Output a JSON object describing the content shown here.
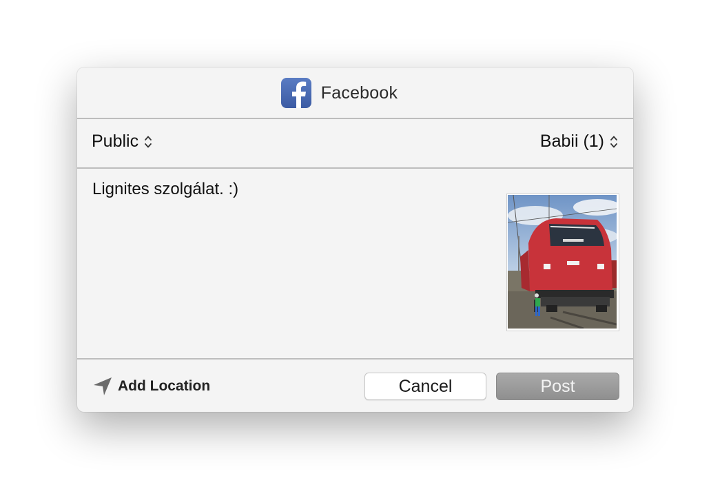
{
  "dialog": {
    "title": "Facebook",
    "logo_icon": "facebook-logo-icon"
  },
  "audience": {
    "label": "Public",
    "icon": "updown-chevron-icon"
  },
  "account": {
    "label": "Babii (1)",
    "icon": "updown-chevron-icon"
  },
  "compose": {
    "text": "Lignites szolgálat. :)",
    "attachment": "photo-thumbnail"
  },
  "footer": {
    "add_location_label": "Add Location",
    "add_location_icon": "location-arrow-icon",
    "cancel_label": "Cancel",
    "post_label": "Post"
  },
  "colors": {
    "facebook_blue": "#3b5ba3",
    "post_button": "#9c9c9c",
    "dialog_bg": "#f4f4f4"
  }
}
